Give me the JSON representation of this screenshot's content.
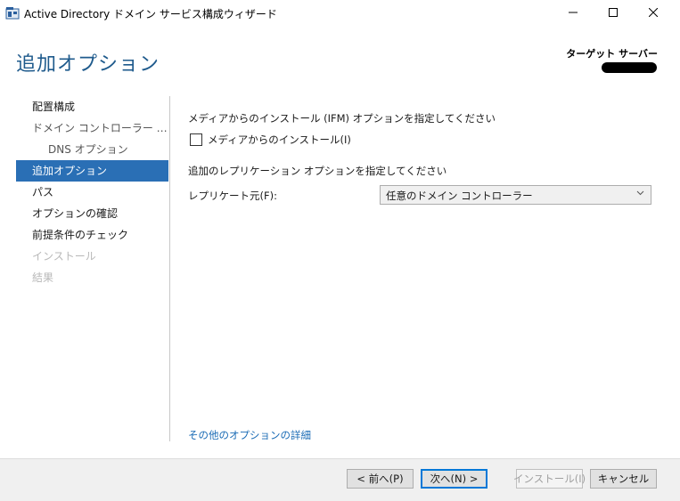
{
  "window": {
    "title": "Active Directory ドメイン サービス構成ウィザード",
    "minimize_icon": "minimize-icon",
    "maximize_icon": "maximize-icon",
    "close_icon": "close-icon"
  },
  "header": {
    "page_title": "追加オプション",
    "target_server_label": "ターゲット サーバー"
  },
  "nav": {
    "items": [
      {
        "label": "配置構成",
        "state": "normal"
      },
      {
        "label": "ドメイン コントローラー オプション",
        "state": "muted"
      },
      {
        "label": "DNS オプション",
        "state": "muted"
      },
      {
        "label": "追加オプション",
        "state": "active"
      },
      {
        "label": "パス",
        "state": "normal"
      },
      {
        "label": "オプションの確認",
        "state": "normal"
      },
      {
        "label": "前提条件のチェック",
        "state": "normal"
      },
      {
        "label": "インストール",
        "state": "disabled"
      },
      {
        "label": "結果",
        "state": "disabled"
      }
    ]
  },
  "main": {
    "ifm_heading": "メディアからのインストール (IFM) オプションを指定してください",
    "ifm_checkbox_label": "メディアからのインストール(I)",
    "ifm_checked": false,
    "replication_heading": "追加のレプリケーション オプションを指定してください",
    "replicate_from_label": "レプリケート元(F):",
    "replicate_from_value": "任意のドメイン コントローラー",
    "more_options_link": "その他のオプションの詳細"
  },
  "footer": {
    "prev_label": "< 前へ(P)",
    "next_label": "次へ(N) >",
    "install_label": "インストール(I)",
    "cancel_label": "キャンセル"
  },
  "colors": {
    "accent": "#2a6fb5",
    "title_blue": "#1e5a8c",
    "link_blue": "#1a6bb5"
  }
}
